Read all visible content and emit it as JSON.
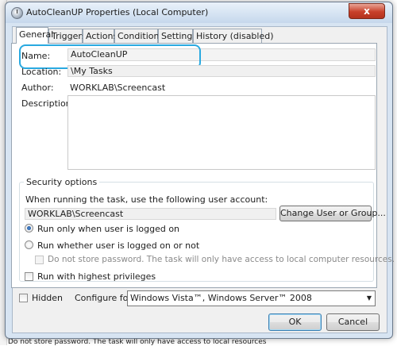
{
  "window": {
    "title": "AutoCleanUP Properties (Local Computer)",
    "close_glyph": "x"
  },
  "tabs": [
    {
      "label": "General",
      "active": true
    },
    {
      "label": "Triggers"
    },
    {
      "label": "Actions"
    },
    {
      "label": "Conditions"
    },
    {
      "label": "Settings"
    },
    {
      "label": "History (disabled)"
    }
  ],
  "general": {
    "name_label": "Name:",
    "name_value": "AutoCleanUP",
    "location_label": "Location:",
    "location_value": "\\My Tasks",
    "author_label": "Author:",
    "author_value": "WORKLAB\\Screencast",
    "description_label": "Description:",
    "description_value": ""
  },
  "security": {
    "title": "Security options",
    "account_prompt": "When running the task, use the following user account:",
    "account_value": "WORKLAB\\Screencast",
    "change_user_button": "Change User or Group...",
    "radio_logged_on": "Run only when user is logged on",
    "radio_logged_on_selected": true,
    "radio_whether": "Run whether user is logged on or not",
    "no_store_password": "Do not store password.  The task will only have access to local computer resources.",
    "highest_privileges": "Run with highest privileges"
  },
  "footer": {
    "hidden_label": "Hidden",
    "configure_label": "Configure for:",
    "configure_value": "Windows Vista™, Windows Server™ 2008",
    "ok_button": "OK",
    "cancel_button": "Cancel"
  },
  "background": {
    "bottom_text": "Do not store password.  The task will only have access to local resources"
  },
  "colors": {
    "highlight": "#29a9e0",
    "close_button": "#c8402a"
  }
}
